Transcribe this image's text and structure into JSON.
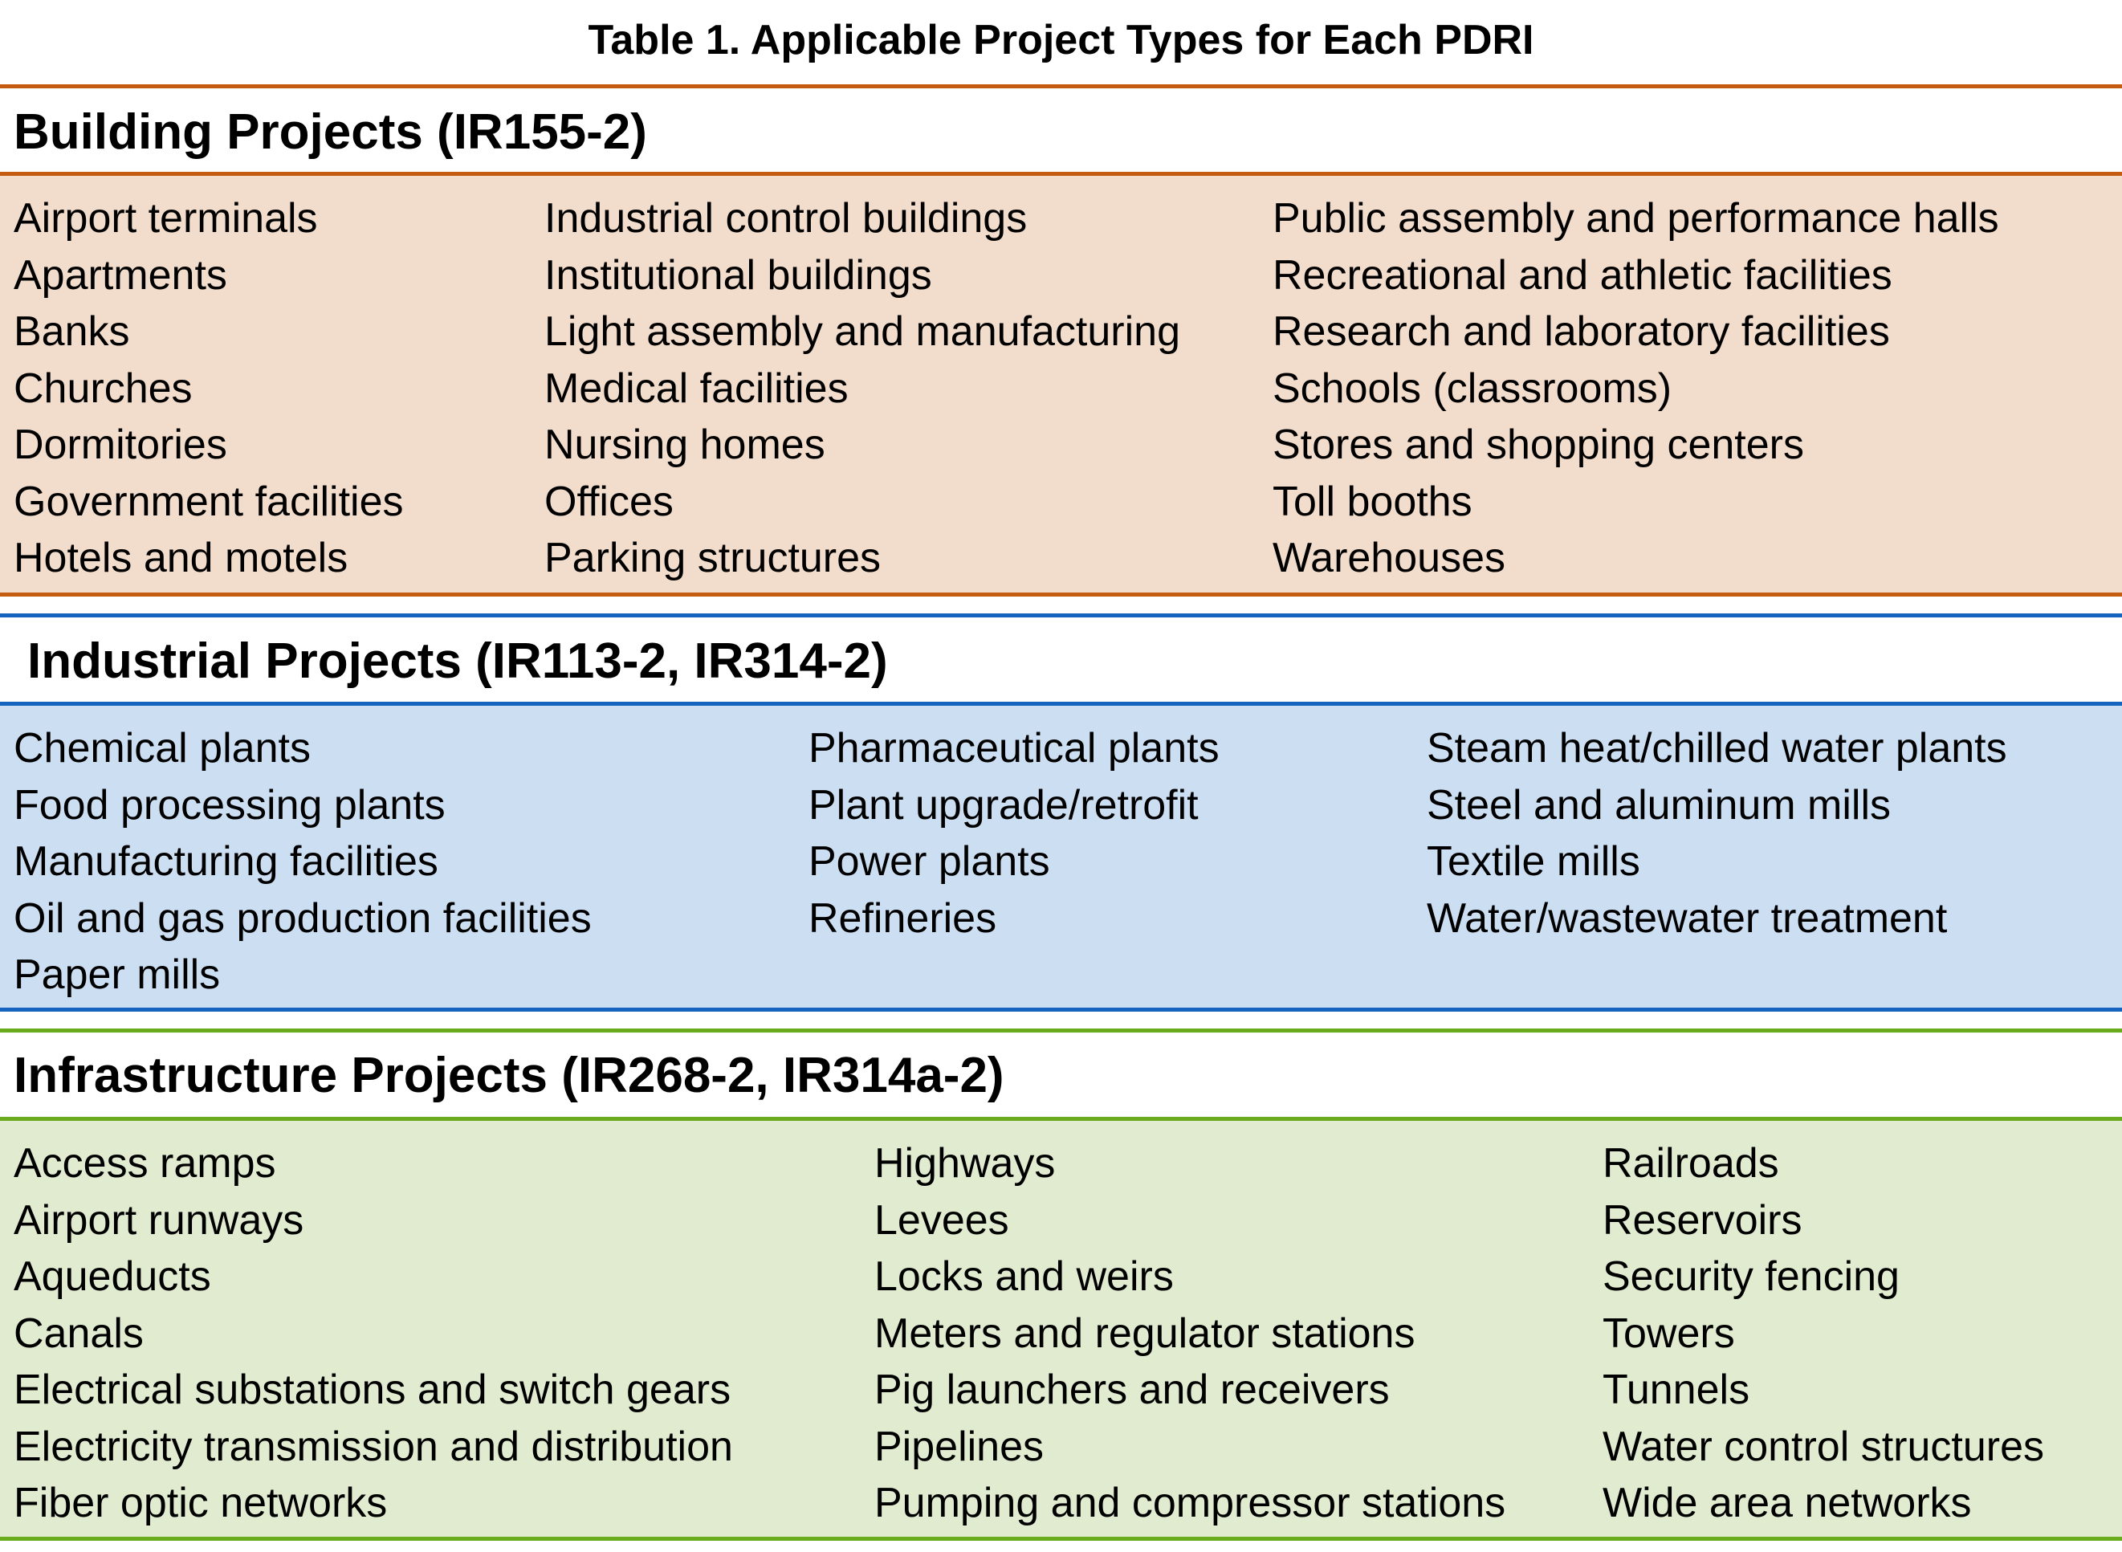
{
  "title": "Table 1. Applicable Project Types for Each PDRI",
  "colors": {
    "building_accent": "#c55a11",
    "building_bg": "#f2dccb",
    "industrial_accent": "#1565c0",
    "industrial_bg": "#ccdef2",
    "infrastructure_accent": "#6aab1e",
    "infrastructure_bg": "#e0ebd0"
  },
  "sections": {
    "building": {
      "heading": "Building Projects (IR155-2)",
      "columns": [
        [
          "Airport terminals",
          "Apartments",
          "Banks",
          "Churches",
          "Dormitories",
          "Government facilities",
          "Hotels and motels"
        ],
        [
          "Industrial control buildings",
          "Institutional buildings",
          "Light assembly and manufacturing",
          "Medical facilities",
          "Nursing homes",
          "Offices",
          "Parking structures"
        ],
        [
          "Public assembly and performance halls",
          "Recreational and athletic facilities",
          "Research and laboratory facilities",
          "Schools (classrooms)",
          "Stores and shopping centers",
          "Toll booths",
          "Warehouses"
        ]
      ]
    },
    "industrial": {
      "heading": "Industrial Projects (IR113-2, IR314-2)",
      "columns": [
        [
          "Chemical plants",
          "Food processing plants",
          "Manufacturing facilities",
          "Oil and gas production facilities",
          "Paper mills"
        ],
        [
          "Pharmaceutical plants",
          "Plant upgrade/retrofit",
          "Power plants",
          "Refineries"
        ],
        [
          "Steam heat/chilled water plants",
          "Steel and aluminum mills",
          "Textile mills",
          "Water/wastewater treatment"
        ]
      ]
    },
    "infrastructure": {
      "heading": "Infrastructure Projects (IR268-2, IR314a-2)",
      "columns": [
        [
          "Access ramps",
          "Airport runways",
          "Aqueducts",
          "Canals",
          "Electrical substations and switch gears",
          "Electricity transmission and distribution",
          "Fiber optic networks"
        ],
        [
          "Highways",
          "Levees",
          "Locks and weirs",
          "Meters and regulator stations",
          "Pig launchers and receivers",
          "Pipelines",
          "Pumping and compressor stations"
        ],
        [
          "Railroads",
          "Reservoirs",
          "Security fencing",
          "Towers",
          "Tunnels",
          "Water control structures",
          "Wide area networks"
        ]
      ]
    }
  }
}
